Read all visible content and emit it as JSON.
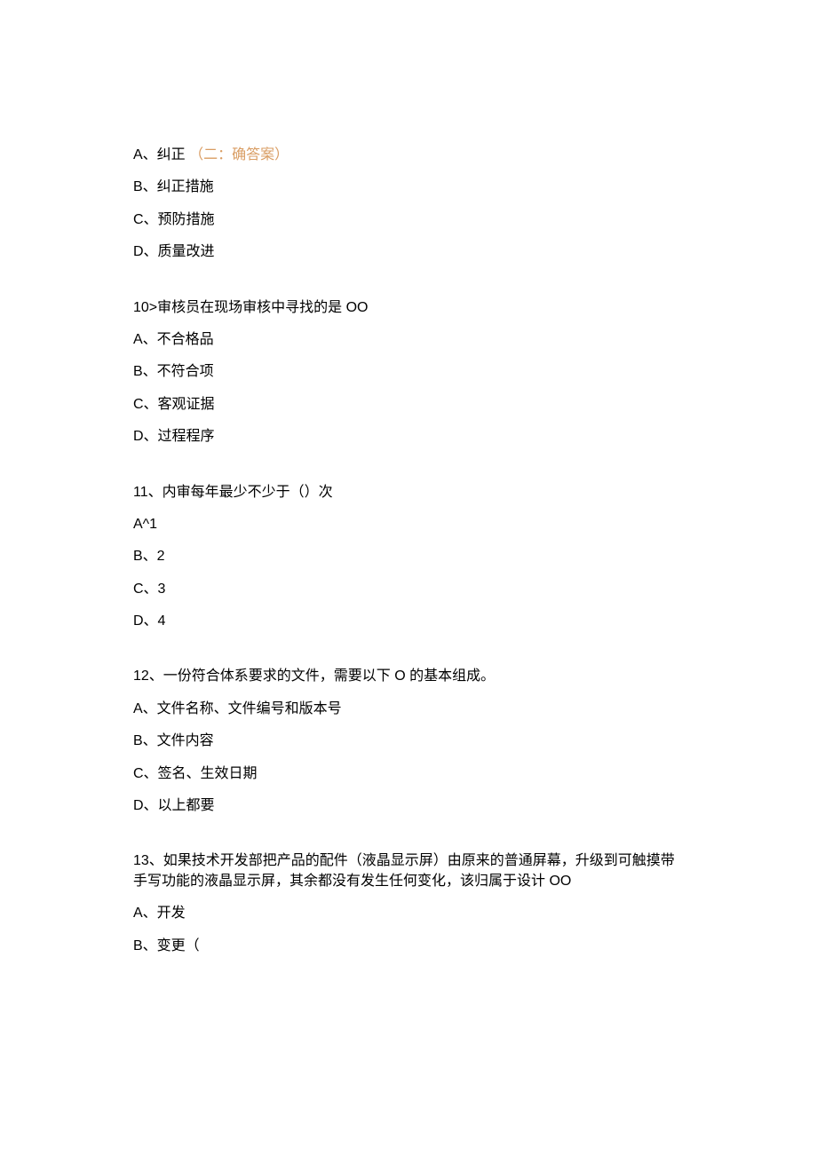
{
  "block1": {
    "optA_prefix": "A、纠正 ",
    "optA_note": "（二：确答案）",
    "optB": "B、纠正措施",
    "optC": "C、预防措施",
    "optD": "D、质量改进"
  },
  "q10": {
    "stem": "10>审核员在现场审核中寻找的是 OO",
    "optA": "A、不合格品",
    "optB": "B、不符合项",
    "optC": "C、客观证据",
    "optD": "D、过程程序"
  },
  "q11": {
    "stem": "11、内审每年最少不少于（）次",
    "optA": "A^1",
    "optB": "B、2",
    "optC": "C、3",
    "optD": "D、4"
  },
  "q12": {
    "stem": "12、一份符合体系要求的文件，需要以下 O 的基本组成。",
    "optA": "A、文件名称、文件编号和版本号",
    "optB": "B、文件内容",
    "optC": "C、签名、生效日期",
    "optD": "D、以上都要"
  },
  "q13": {
    "stem": "13、如果技术开发部把产品的配件（液晶显示屏）由原来的普通屏幕，升级到可触摸带手写功能的液晶显示屏，其余都没有发生任何变化，该归属于设计 OO",
    "optA": "A、开发",
    "optB": "B、变更（"
  }
}
